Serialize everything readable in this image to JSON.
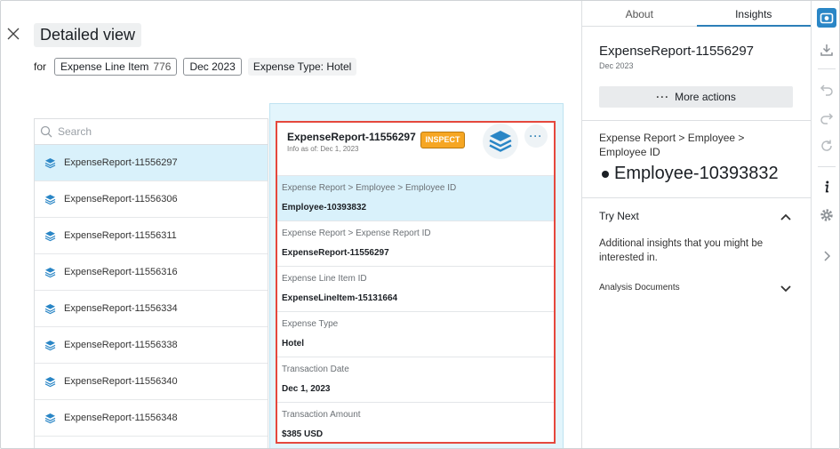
{
  "header": {
    "title": "Detailed view",
    "for_label": "for",
    "chips": [
      {
        "label": "Expense Line Item",
        "count": "776"
      },
      {
        "label": "Dec 2023"
      },
      {
        "label": "Expense Type: Hotel"
      }
    ]
  },
  "list": {
    "search_placeholder": "Search",
    "items": [
      {
        "label": "ExpenseReport-11556297",
        "selected": true
      },
      {
        "label": "ExpenseReport-11556306"
      },
      {
        "label": "ExpenseReport-11556311"
      },
      {
        "label": "ExpenseReport-11556316"
      },
      {
        "label": "ExpenseReport-11556334"
      },
      {
        "label": "ExpenseReport-11556338"
      },
      {
        "label": "ExpenseReport-11556340"
      },
      {
        "label": "ExpenseReport-11556348"
      }
    ]
  },
  "card": {
    "title": "ExpenseReport-11556297",
    "subtitle": "Info as of: Dec 1, 2023",
    "badge": "INSPECT",
    "more": "···",
    "fields": [
      {
        "label": "Expense Report > Employee > Employee ID",
        "value": "Employee-10393832"
      },
      {
        "label": "Expense Report > Expense Report ID",
        "value": "ExpenseReport-11556297"
      },
      {
        "label": "Expense Line Item ID",
        "value": "ExpenseLineItem-15131664"
      },
      {
        "label": "Expense Type",
        "value": "Hotel"
      },
      {
        "label": "Transaction Date",
        "value": "Dec 1, 2023"
      },
      {
        "label": "Transaction Amount",
        "value": "$385 USD"
      }
    ]
  },
  "right_panel": {
    "tabs": [
      {
        "label": "About"
      },
      {
        "label": "Insights",
        "active": true
      }
    ],
    "title": "ExpenseReport-11556297",
    "date": "Dec 2023",
    "more_actions": "More actions",
    "path": "Expense Report > Employee > Employee ID",
    "value": "Employee-10393832",
    "try_next": "Try Next",
    "try_next_desc": "Additional insights that you might be interested in.",
    "analysis_docs": "Analysis Documents"
  },
  "colors": {
    "accent": "#2c7fb8",
    "highlight": "#d9f1fb",
    "inspect_badge": "#f6a623",
    "card_border": "#e5483d"
  }
}
